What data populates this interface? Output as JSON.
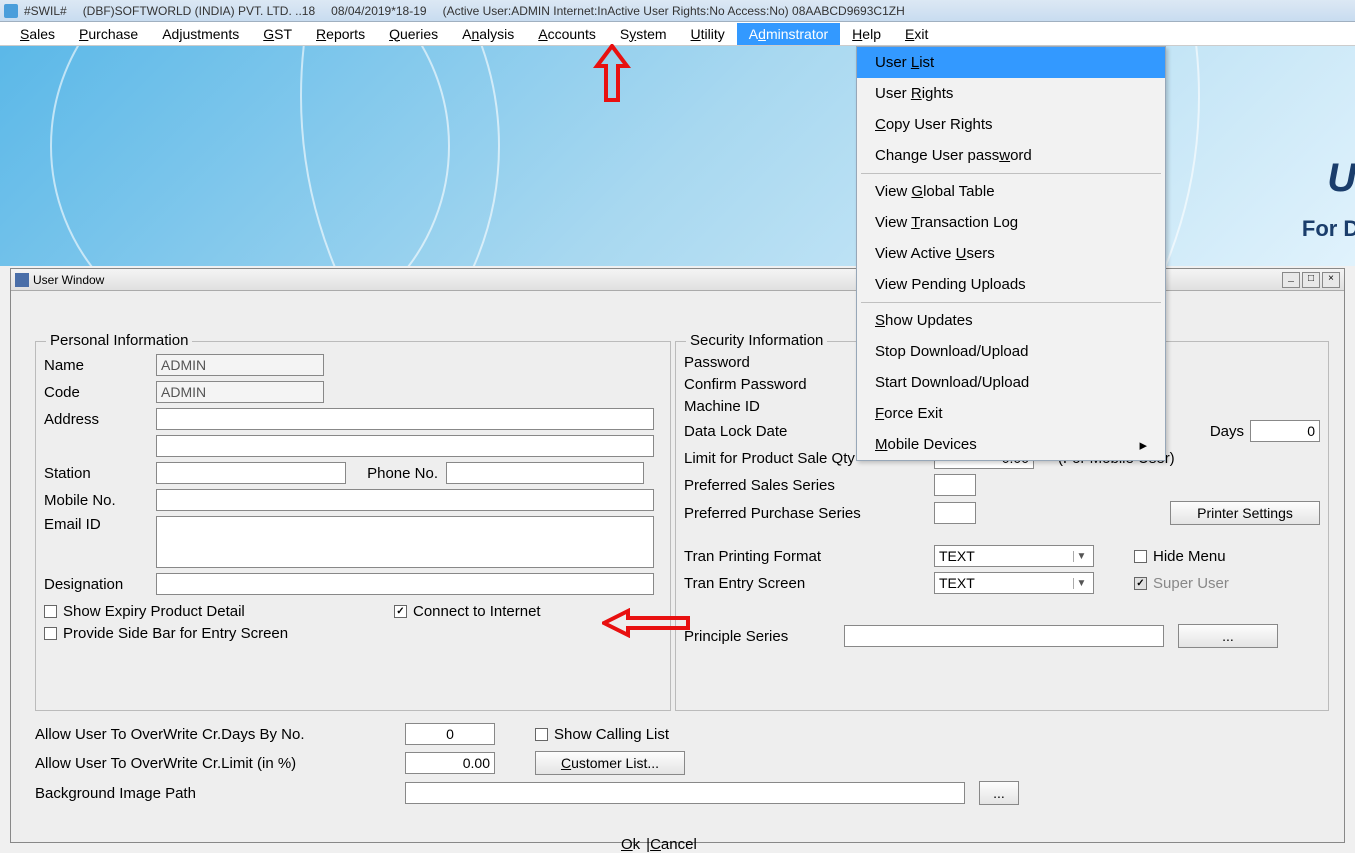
{
  "titlebar": {
    "app_tag": "#SWIL#",
    "company": "(DBF)SOFTWORLD (INDIA) PVT. LTD. ..18",
    "date": "08/04/2019*18-19",
    "status": "(Active User:ADMIN Internet:InActive User Rights:No Access:No) 08AABCD9693C1ZH"
  },
  "menubar": {
    "items": [
      {
        "label": "Sales",
        "u": "S"
      },
      {
        "label": "Purchase",
        "u": "P"
      },
      {
        "label": "Adjustments",
        "u": "j"
      },
      {
        "label": "GST",
        "u": "G"
      },
      {
        "label": "Reports",
        "u": "R"
      },
      {
        "label": "Queries",
        "u": "Q"
      },
      {
        "label": "Analysis",
        "u": "n"
      },
      {
        "label": "Accounts",
        "u": "A"
      },
      {
        "label": "System",
        "u": "y"
      },
      {
        "label": "Utility",
        "u": "U"
      },
      {
        "label": "Adminstrator",
        "u": "d",
        "active": true
      },
      {
        "label": "Help",
        "u": "H"
      },
      {
        "label": "Exit",
        "u": "E"
      }
    ]
  },
  "dropdown": {
    "groups": [
      [
        {
          "label": "User List",
          "u": "L",
          "hl": true
        },
        {
          "label": "User Rights",
          "u": "R"
        },
        {
          "label": "Copy User Rights",
          "u": "C"
        },
        {
          "label": "Change User password",
          "u": "w"
        }
      ],
      [
        {
          "label": "View Global Table",
          "u": "G"
        },
        {
          "label": "View Transaction Log",
          "u": "T"
        },
        {
          "label": "View Active Users",
          "u": "U"
        },
        {
          "label": "View Pending Uploads"
        }
      ],
      [
        {
          "label": "Show Updates",
          "u": "S"
        },
        {
          "label": "Stop Download/Upload"
        },
        {
          "label": "Start Download/Upload"
        },
        {
          "label": "Force Exit",
          "u": "F"
        },
        {
          "label": "Mobile Devices",
          "u": "M",
          "arrow": true
        }
      ]
    ]
  },
  "banner": {
    "brand": "UN",
    "tagline": "For Dist"
  },
  "user_window": {
    "title": "User Window",
    "personal": {
      "group": "Personal Information",
      "name_label": "Name",
      "name_val": "ADMIN",
      "code_label": "Code",
      "code_val": "ADMIN",
      "address_label": "Address",
      "station_label": "Station",
      "phone_label": "Phone No.",
      "mobile_label": "Mobile No.",
      "email_label": "Email ID",
      "designation_label": "Designation",
      "expiry_label": "Show Expiry Product Detail",
      "connect_label": "Connect to Internet",
      "sidebar_label": "Provide Side Bar for Entry Screen"
    },
    "security": {
      "group": "Security Information",
      "password_label": "Password",
      "confirm_label": "Confirm Password",
      "machine_label": "Machine ID",
      "datalock_label": "Data Lock Date",
      "days_label": "Days",
      "days_val": "0",
      "limit_label": "Limit for Product Sale Qty",
      "limit_val": "0.00",
      "mobile_user_label": "(For Mobile User)",
      "pref_sales_label": "Preferred Sales Series",
      "pref_purchase_label": "Preferred Purchase Series",
      "printer_btn": "Printer Settings",
      "tran_print_label": "Tran Printing Format",
      "tran_print_val": "TEXT",
      "tran_entry_label": "Tran Entry Screen",
      "tran_entry_val": "TEXT",
      "hide_menu_label": "Hide Menu",
      "super_user_label": "Super User",
      "principle_label": "Principle Series",
      "dots_btn": "..."
    },
    "bottom": {
      "crdays_label": "Allow User To OverWrite Cr.Days By No.",
      "crdays_val": "0",
      "crlimit_label": "Allow User To OverWrite Cr.Limit (in %)",
      "crlimit_val": "0.00",
      "calling_label": "Show Calling List",
      "customer_btn": "Customer List...",
      "bgpath_label": "Background Image Path",
      "dots_btn": "..."
    },
    "ok": "Ok",
    "cancel": "Cancel"
  }
}
